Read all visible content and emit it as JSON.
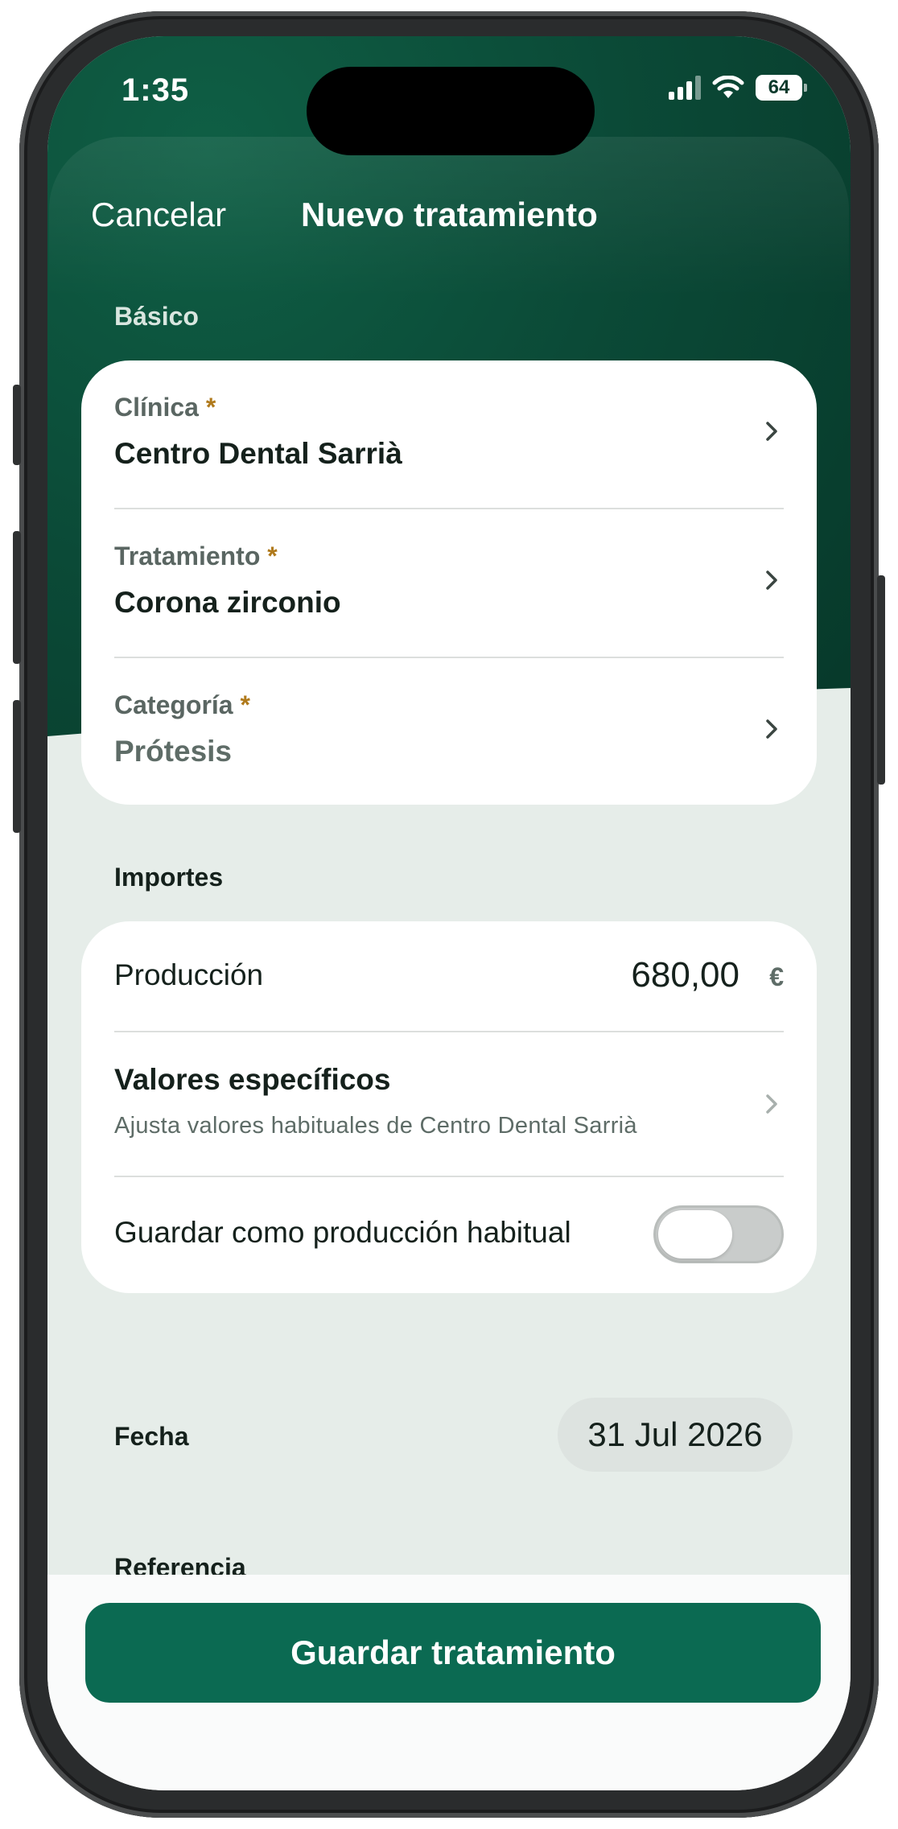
{
  "status_bar": {
    "time": "1:35",
    "battery": "64"
  },
  "nav": {
    "cancel_label": "Cancelar",
    "title": "Nuevo tratamiento"
  },
  "basico": {
    "section_label": "Básico",
    "required_marker": "*",
    "fields": [
      {
        "label": "Clínica",
        "value": "Centro Dental Sarrià"
      },
      {
        "label": "Tratamiento",
        "value": "Corona zirconio"
      },
      {
        "label": "Categoría",
        "value": "Prótesis"
      }
    ]
  },
  "importes": {
    "section_label": "Importes",
    "produccion_label": "Producción",
    "produccion_value": "680,00",
    "currency": "€",
    "especificos_title": "Valores específicos",
    "especificos_subtitle": "Ajusta valores habituales de Centro Dental Sarrià",
    "guardar_habitual_label": "Guardar como producción habitual",
    "guardar_habitual_on": false
  },
  "fecha": {
    "label": "Fecha",
    "value": "31 Jul 2026"
  },
  "next_section_partial": "Referencia",
  "actions": {
    "save_label": "Guardar tratamiento"
  },
  "colors": {
    "brand_dark": "#0b4a37",
    "accent_button": "#0b6a52",
    "required": "#b07a1c",
    "background": "#e6ede9"
  }
}
